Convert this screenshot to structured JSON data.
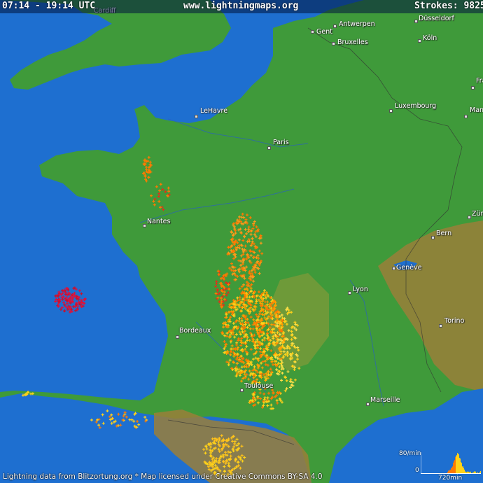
{
  "header": {
    "time_range": "07:14 - 19:14 UTC",
    "site": "www.lightningmaps.org",
    "strokes_label": "Strokes:",
    "strokes_count": "9825"
  },
  "footer": {
    "credit": "Lightning data from Blitzortung.org  *  Map licensed under Creative Commons BY-SA 4.0"
  },
  "histogram": {
    "max_label": "80/min",
    "zero_label": "0",
    "span_label": "720min"
  },
  "cities": {
    "cardiff": "Cardiff",
    "antwerpen": "Antwerpen",
    "gent": "Gent",
    "bruxelles": "Bruxelles",
    "koln": "Köln",
    "dusseldorf": "Düsseldorf",
    "luxembourg": "Luxembourg",
    "lehavre": "LeHavre",
    "paris": "Paris",
    "nantes": "Nantes",
    "bern": "Bern",
    "geneve": "Genève",
    "lyon": "Lyon",
    "bordeaux": "Bordeaux",
    "torino": "Torino",
    "toulouse": "Toulouse",
    "marseille": "Marseille",
    "zurich": "Zür",
    "frankfurt": "Fra",
    "mannheim": "Mann"
  },
  "colors": {
    "sea": "#1e6fd0",
    "land": "#3f9a3a",
    "highland": "#9a8a3a",
    "strike_recent": "#ffd21a",
    "strike_old": "#ff7a00",
    "strike_oldest": "#c8102e"
  }
}
